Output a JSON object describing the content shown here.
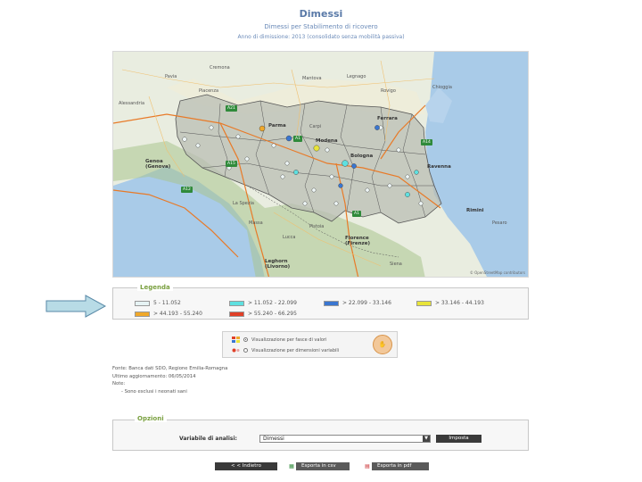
{
  "header": {
    "title": "Dimessi",
    "subtitle": "Dimessi per Stabilimento di ricovero",
    "description": "Anno di dimissione: 2013 (consolidato senza mobilità passiva)"
  },
  "map": {
    "labels": [
      {
        "text": "Pavia"
      },
      {
        "text": "Cremona"
      },
      {
        "text": "Mantova"
      },
      {
        "text": "Legnago"
      },
      {
        "text": "Rovigo"
      },
      {
        "text": "Chioggia"
      },
      {
        "text": "Piacenza"
      },
      {
        "text": "Alessandria"
      },
      {
        "text": "Ferrara"
      },
      {
        "text": "Parma"
      },
      {
        "text": "Carpi"
      },
      {
        "text": "Modena"
      },
      {
        "text": "Bologna"
      },
      {
        "text": "Ravenna"
      },
      {
        "text": "Genoa\n(Genova)"
      },
      {
        "text": "Rimini"
      },
      {
        "text": "La Spezia"
      },
      {
        "text": "Pistoia"
      },
      {
        "text": "Florence\n(Firenze)"
      },
      {
        "text": "Leghorn\n(Livorno)"
      },
      {
        "text": "Siena"
      },
      {
        "text": "Pesaro"
      },
      {
        "text": "Massa"
      },
      {
        "text": "Lucca"
      }
    ],
    "roads": [
      "A21",
      "A1",
      "A15",
      "A12",
      "A1",
      "A14"
    ],
    "copyright": "© OpenStreetMap contributors"
  },
  "legend": {
    "title": "Legenda",
    "items": [
      {
        "label": "5 - 11.052",
        "color": "#e6f3f4"
      },
      {
        "label": "> 11.052 - 22.099",
        "color": "#5fe0e0"
      },
      {
        "label": "> 22.099 - 33.146",
        "color": "#3a76d0"
      },
      {
        "label": "> 33.146 - 44.193",
        "color": "#e8e43a"
      },
      {
        "label": "> 44.193 - 55.240",
        "color": "#f0a82a"
      },
      {
        "label": "> 55.240 - 66.295",
        "color": "#e04028"
      }
    ]
  },
  "visualization": {
    "option1": "Visualizzazione per fasce di valori",
    "option2": "Visualizzazione per dimensioni variabili",
    "selected": 1
  },
  "notes": {
    "source": "Fonte: Banca dati SDO, Regione Emilia-Romagna",
    "updated": "Ultimo aggiornamento: 06/05/2014",
    "notes_label": "Note:",
    "note1": "- Sono esclusi i neonati sani"
  },
  "options": {
    "title": "Opzioni",
    "variable_label": "Variabile di analisi:",
    "variable_value": "Dimessi",
    "apply": "Imposta"
  },
  "footer": {
    "back": "< < Indietro",
    "csv": "Esporta in csv",
    "pdf": "Esporta in pdf"
  }
}
